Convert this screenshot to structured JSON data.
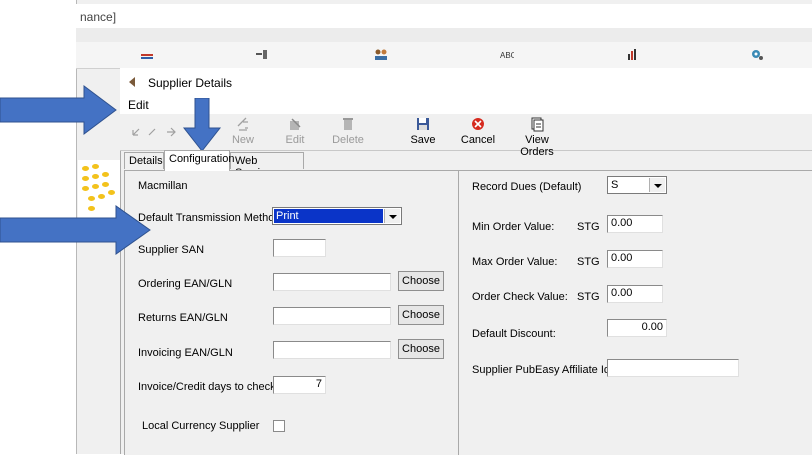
{
  "background_window": {
    "title_fragment": "nance]"
  },
  "dialog": {
    "title": "Supplier Details",
    "menu": {
      "edit": "Edit"
    }
  },
  "toolbar": {
    "new_label": "New",
    "edit_label": "Edit",
    "delete_label": "Delete",
    "save_label": "Save",
    "cancel_label": "Cancel",
    "view_orders_label": "View Orders"
  },
  "tabs": {
    "details": "Details",
    "configuration": "Configuration",
    "web_services": "Web Services",
    "selected": "Configuration"
  },
  "left": {
    "supplier_name": "Macmillan",
    "transmission_label": "Default Transmission Method",
    "transmission_value": "Print",
    "san_label": "Supplier SAN",
    "san_value": "",
    "ordering_label": "Ordering EAN/GLN",
    "ordering_value": "",
    "returns_label": "Returns EAN/GLN",
    "returns_value": "",
    "invoicing_label": "Invoicing EAN/GLN",
    "invoicing_value": "",
    "choose_label": "Choose",
    "days_label": "Invoice/Credit days to check",
    "days_value": "7",
    "local_currency_label": "Local Currency Supplier",
    "local_currency_checked": false
  },
  "right": {
    "record_dues_label": "Record Dues (Default)",
    "record_dues_value": "S",
    "min_order_label": "Min Order Value:",
    "min_order_currency": "STG",
    "min_order_value": "0.00",
    "max_order_label": "Max Order Value:",
    "max_order_currency": "STG",
    "max_order_value": "0.00",
    "order_check_label": "Order Check Value:",
    "order_check_currency": "STG",
    "order_check_value": "0.00",
    "discount_label": "Default Discount:",
    "discount_value": "0.00",
    "pubeasy_label": "Supplier PubEasy Affiliate Id",
    "pubeasy_value": ""
  },
  "colors": {
    "arrow": "#4472c4",
    "selection": "#0a34c8",
    "logo_dots": "#f3c21b"
  }
}
